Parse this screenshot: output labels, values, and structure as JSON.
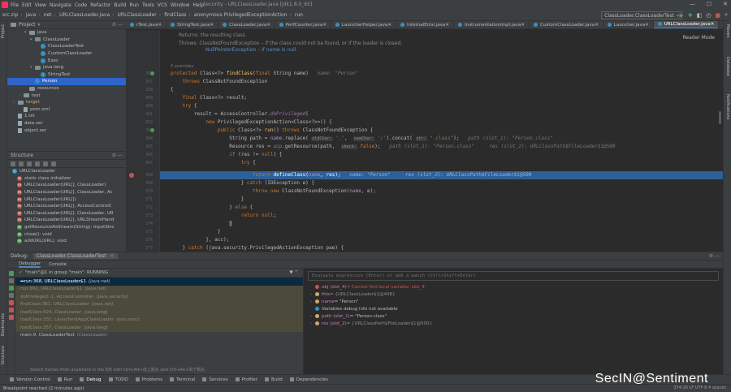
{
  "menubar": {
    "items": [
      "File",
      "Edit",
      "View",
      "Navigate",
      "Code",
      "Refactor",
      "Build",
      "Run",
      "Tools",
      "VCS",
      "Window",
      "Help"
    ],
    "window_title": "Security - URLClassLoader.java [jdk1.8.0_65]"
  },
  "navbar": {
    "crumbs": [
      "src.zip",
      "java",
      "net",
      "URLClassLoader.java",
      "URLClassLoader",
      "findClass",
      "anonymous PrivilegedExceptionAction",
      "run"
    ],
    "run_config": "ClassLoader.ClassLoaderTest"
  },
  "project": {
    "title": "Project",
    "tree": [
      {
        "label": "java",
        "indent": 3,
        "type": "folder",
        "arrow": "▾"
      },
      {
        "label": "ClassLoader",
        "indent": 4,
        "type": "pkg",
        "arrow": "▾"
      },
      {
        "label": "ClassLoaderTest",
        "indent": 5,
        "type": "class",
        "arrow": ""
      },
      {
        "label": "CustomClassLoader",
        "indent": 5,
        "type": "class",
        "arrow": ""
      },
      {
        "label": "Exec",
        "indent": 5,
        "type": "class",
        "arrow": ""
      },
      {
        "label": "java.lang",
        "indent": 4,
        "type": "pkg",
        "arrow": "▾"
      },
      {
        "label": "StringTest",
        "indent": 5,
        "type": "class",
        "arrow": ""
      },
      {
        "label": "Person",
        "indent": 4,
        "type": "class",
        "arrow": "",
        "selected": true
      },
      {
        "label": "resources",
        "indent": 3,
        "type": "folder",
        "arrow": ""
      },
      {
        "label": "test",
        "indent": 2,
        "type": "folder",
        "arrow": "›"
      },
      {
        "label": "target",
        "indent": 1,
        "type": "folder",
        "arrow": "›"
      },
      {
        "label": "pom.xml",
        "indent": 2,
        "type": "file",
        "arrow": ""
      },
      {
        "label": "1.txt",
        "indent": 1,
        "type": "file",
        "arrow": ""
      },
      {
        "label": "data.ser",
        "indent": 1,
        "type": "file",
        "arrow": ""
      },
      {
        "label": "object.ser",
        "indent": 1,
        "type": "file",
        "arrow": ""
      }
    ]
  },
  "structure": {
    "title": "Structure",
    "items": [
      {
        "label": "URLClassLoader",
        "icon": "blue",
        "indent": 1
      },
      {
        "label": "static class initializer",
        "icon": "red",
        "indent": 2
      },
      {
        "label": "URLClassLoader(URL[], ClassLoader)",
        "icon": "red",
        "indent": 2
      },
      {
        "label": "URLClassLoader(URL[], ClassLoader, Ac",
        "icon": "red",
        "indent": 2
      },
      {
        "label": "URLClassLoader(URL[])",
        "icon": "red",
        "indent": 2
      },
      {
        "label": "URLClassLoader(URL[], AccessControlC",
        "icon": "red",
        "indent": 2
      },
      {
        "label": "URLClassLoader(URL[], ClassLoader, UR",
        "icon": "red",
        "indent": 2
      },
      {
        "label": "URLClassLoader(URL[], URLStreamHand",
        "icon": "red",
        "indent": 2
      },
      {
        "label": "getResourceAsStream(String): InputStre",
        "icon": "green",
        "indent": 2
      },
      {
        "label": "close(): void",
        "icon": "green",
        "indent": 2
      },
      {
        "label": "addURL(URL): void",
        "icon": "green",
        "indent": 2
      }
    ]
  },
  "editor": {
    "tabs": [
      "rTest.java",
      "StringTest.java",
      "ClassLoader.java",
      "PerfCounter.java",
      "LauncherHelper.java",
      "InternalError.java",
      "InstrumentationImpl.java",
      "CustomClassLoader.java",
      "Launcher.java",
      "URLClassLoader.java"
    ],
    "active_tab": "URLClassLoader.java",
    "reader_mode": "Reader Mode",
    "doc_returns": "Returns: the resulting class",
    "doc_throws_1": "Throws: ClassNotFoundException – if the class could not be found, or if the loader is closed.",
    "doc_throws_2": "NullPointerException – if name is null.",
    "overrides": "5 overrides",
    "line_numbers": [
      "356",
      "357",
      "358",
      "359",
      "360",
      "361",
      "362",
      "363",
      "364",
      "365",
      "366",
      "367",
      "368",
      "369",
      "370",
      "371",
      "372",
      "373",
      "374",
      "375",
      "376",
      "377"
    ]
  },
  "debug": {
    "title": "Debug:",
    "session": "ClassLoader.ClassLoaderTest",
    "tabs": [
      "Debugger",
      "Console"
    ],
    "thread": "\"main\"@1 in group \"main\": RUNNING",
    "frames": [
      {
        "method": "run:368, URLClassLoader$1",
        "pkg": "(java.net)",
        "kind": "active"
      },
      {
        "method": "run:361, URLClassLoader$1",
        "pkg": "(java.net)",
        "kind": "lib"
      },
      {
        "method": "doPrivileged:-1, AccessController",
        "pkg": "(java.security)",
        "kind": "lib"
      },
      {
        "method": "findClass:361, URLClassLoader",
        "pkg": "(java.net)",
        "kind": "lib"
      },
      {
        "method": "loadClass:424, ClassLoader",
        "pkg": "(java.lang)",
        "kind": "lib"
      },
      {
        "method": "loadClass:331, Launcher$AppClassLoader",
        "pkg": "(sun.misc)",
        "kind": "lib"
      },
      {
        "method": "loadClass:357, ClassLoader",
        "pkg": "(java.lang)",
        "kind": "lib"
      },
      {
        "method": "main:9, ClassLoaderTest",
        "pkg": "(ClassLoader)",
        "kind": "normal"
      }
    ],
    "frames_hint": "Switch frames from anywhere in the IDE with Ctrl+Alt+向上箭头 and Ctrl+Alt+向下箭头",
    "eval_placeholder": "Evaluate expression (Enter) or add a watch (Ctrl+Shift+Enter)",
    "vars": [
      {
        "exp": "",
        "name": "obj (slot_4)",
        "value": " = Cannot find local variable 'slot_4'",
        "kind": "error"
      },
      {
        "exp": "›",
        "name": "this",
        "value": " = {URLClassLoader$1@498}",
        "kind": "obj"
      },
      {
        "exp": "›",
        "name": "name",
        "value": " = \"Person\"",
        "kind": "str"
      },
      {
        "exp": "",
        "name": "",
        "value": "Variables debug info not available",
        "kind": "info"
      },
      {
        "exp": "›",
        "name": "path (slot_1)",
        "value": " = \"Person.class\"",
        "kind": "str"
      },
      {
        "exp": "›",
        "name": "res (slot_2)",
        "value": " = {URLClassPath$FileLoader$1@500}",
        "kind": "obj"
      }
    ]
  },
  "bottom_tools": [
    "Version Control",
    "Run",
    "Debug",
    "TODO",
    "Problems",
    "Terminal",
    "Services",
    "Profiler",
    "Build",
    "Dependencies"
  ],
  "status": {
    "left": "Breakpoint reached (2 minutes ago)",
    "right": "374:26   LF   UTF-8   4 spaces"
  },
  "watermark": "SecIN@Sentiment",
  "colors": {
    "accent": "#2d6099",
    "keyword": "#cc7832",
    "method": "#ffc66d",
    "string": "#6a8759"
  }
}
